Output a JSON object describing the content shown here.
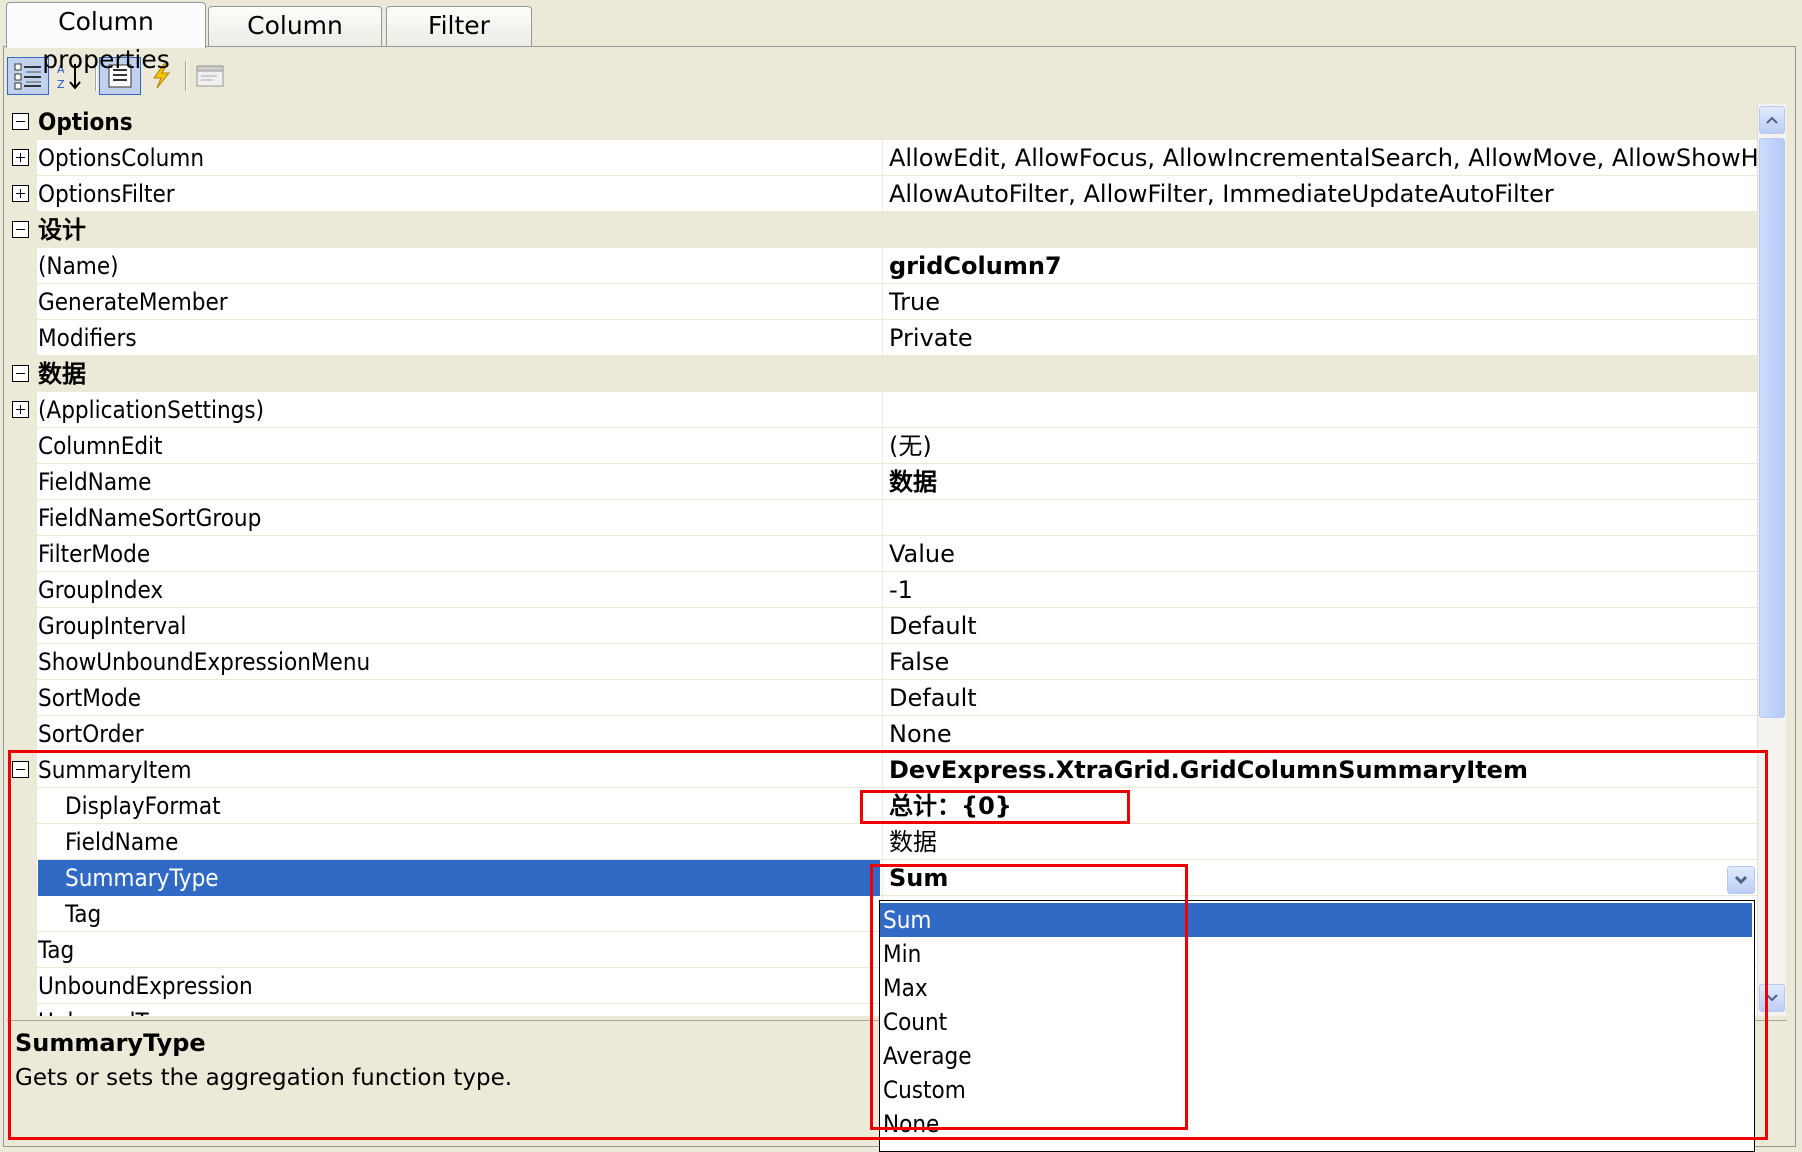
{
  "tabs": [
    {
      "label": "Column properties",
      "active": true
    },
    {
      "label": "Column options",
      "active": false
    },
    {
      "label": "Filter options",
      "active": false
    }
  ],
  "toolbar": {
    "buttons": [
      "categorized-icon",
      "alphabetical-icon",
      "properties-icon",
      "events-icon",
      "property-pages-icon"
    ]
  },
  "grid": {
    "rows": [
      {
        "type": "category",
        "expander": "minus",
        "name": "Options",
        "value": ""
      },
      {
        "type": "prop",
        "expander": "plus",
        "name": "OptionsColumn",
        "value": "AllowEdit, AllowFocus, AllowIncrementalSearch, AllowMove, AllowShowHide, All"
      },
      {
        "type": "prop",
        "expander": "plus",
        "name": "OptionsFilter",
        "value": "AllowAutoFilter, AllowFilter, ImmediateUpdateAutoFilter"
      },
      {
        "type": "category",
        "expander": "minus",
        "name": "设计",
        "value": ""
      },
      {
        "type": "prop",
        "name": "(Name)",
        "value": "gridColumn7",
        "bold": true
      },
      {
        "type": "prop",
        "name": "GenerateMember",
        "value": "True"
      },
      {
        "type": "prop",
        "name": "Modifiers",
        "value": "Private"
      },
      {
        "type": "category",
        "expander": "minus",
        "name": "数据",
        "value": ""
      },
      {
        "type": "prop",
        "expander": "plus",
        "name": "(ApplicationSettings)",
        "value": ""
      },
      {
        "type": "prop",
        "name": "ColumnEdit",
        "value": "(无)"
      },
      {
        "type": "prop",
        "name": "FieldName",
        "value": "数据",
        "bold": true
      },
      {
        "type": "prop",
        "name": "FieldNameSortGroup",
        "value": ""
      },
      {
        "type": "prop",
        "name": "FilterMode",
        "value": "Value"
      },
      {
        "type": "prop",
        "name": "GroupIndex",
        "value": "-1"
      },
      {
        "type": "prop",
        "name": "GroupInterval",
        "value": "Default"
      },
      {
        "type": "prop",
        "name": "ShowUnboundExpressionMenu",
        "value": "False"
      },
      {
        "type": "prop",
        "name": "SortMode",
        "value": "Default"
      },
      {
        "type": "prop",
        "name": "SortOrder",
        "value": "None"
      },
      {
        "type": "prop",
        "expander": "minus",
        "name": "SummaryItem",
        "value": "DevExpress.XtraGrid.GridColumnSummaryItem",
        "bold": true
      },
      {
        "type": "prop",
        "indent": true,
        "name": "DisplayFormat",
        "value": "总计：{0}",
        "bold": true
      },
      {
        "type": "prop",
        "indent": true,
        "name": "FieldName",
        "value": "数据"
      },
      {
        "type": "prop",
        "indent": true,
        "name": "SummaryType",
        "value": "Sum",
        "bold": true,
        "selected": true
      },
      {
        "type": "prop",
        "indent": true,
        "name": "Tag",
        "value": ""
      },
      {
        "type": "prop",
        "name": "Tag",
        "value": ""
      },
      {
        "type": "prop",
        "name": "UnboundExpression",
        "value": ""
      },
      {
        "type": "prop",
        "name": "UnboundType",
        "value": ""
      }
    ]
  },
  "dropdown": {
    "options": [
      "Sum",
      "Min",
      "Max",
      "Count",
      "Average",
      "Custom",
      "None"
    ],
    "selected": "Sum"
  },
  "description": {
    "title": "SummaryType",
    "text": "Gets or sets the aggregation function type."
  },
  "annotations": {
    "color": "#e00000"
  },
  "colors": {
    "selection": "#316ac5",
    "category": "#ece9d8"
  }
}
